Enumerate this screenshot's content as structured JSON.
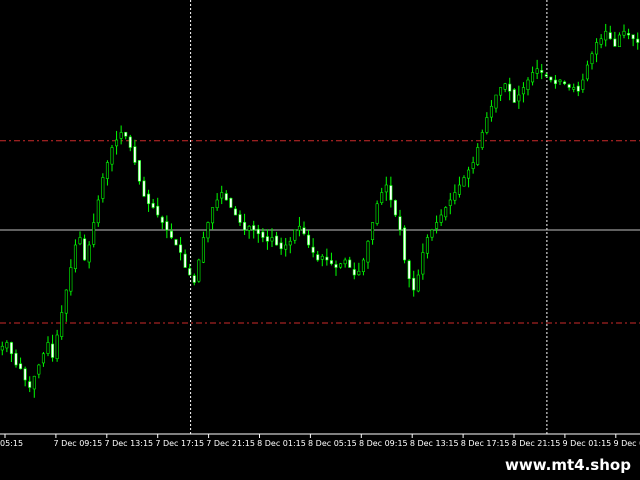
{
  "chart_data": {
    "type": "candlestick",
    "title": "",
    "xlabel": "",
    "ylabel": "",
    "grid": false,
    "colors": {
      "background": "#000000",
      "bull": "#00ff00",
      "bear": "#ffffff",
      "wick": "#00ff00",
      "axis": "#ffffff",
      "level": "#cc2a2a",
      "current": "#c0c0c0",
      "vline": "#ffffff"
    },
    "ylim": [
      0,
      100
    ],
    "x_ticks": [
      "05:15",
      "7 Dec 09:15",
      "7 Dec 13:15",
      "7 Dec 17:15",
      "7 Dec 21:15",
      "8 Dec 01:15",
      "8 Dec 05:15",
      "8 Dec 09:15",
      "8 Dec 13:15",
      "8 Dec 17:15",
      "8 Dec 21:15",
      "9 Dec 01:15",
      "9 Dec 05:15",
      "9"
    ],
    "levels": [
      71.8,
      23.2
    ],
    "current_level": 48.0,
    "vertical_markers": [
      "7 Dec 21:15",
      "9 Dec 01:15"
    ],
    "close": [
      17,
      18,
      15,
      12,
      11,
      8,
      6,
      9,
      12,
      15,
      18,
      14,
      20,
      26,
      32,
      38,
      44,
      46,
      40,
      44,
      50,
      56,
      62,
      66,
      70,
      72,
      74,
      73,
      70,
      66,
      61,
      57,
      55,
      54,
      52,
      50,
      48,
      46,
      44,
      42,
      38,
      36,
      34,
      40,
      46,
      50,
      54,
      56,
      58,
      56,
      54,
      52,
      50,
      48,
      49,
      48,
      47,
      46,
      45,
      46,
      44,
      43,
      44,
      45,
      48,
      49,
      47,
      44,
      42,
      40,
      41,
      40,
      39,
      38,
      39,
      40,
      38,
      36,
      37,
      40,
      45,
      50,
      55,
      58,
      60,
      56,
      52,
      48,
      40,
      35,
      32,
      36,
      42,
      46,
      48,
      50,
      52,
      54,
      56,
      58,
      60,
      62,
      64,
      66,
      70,
      74,
      78,
      81,
      84,
      86,
      87,
      85,
      82,
      84,
      86,
      88,
      90,
      91,
      90,
      89,
      88,
      87,
      88,
      87,
      86,
      86,
      85,
      88,
      92,
      95,
      98,
      99,
      101,
      99,
      97,
      100,
      101,
      100,
      99,
      98
    ]
  },
  "watermark": "www.mt4.shop"
}
